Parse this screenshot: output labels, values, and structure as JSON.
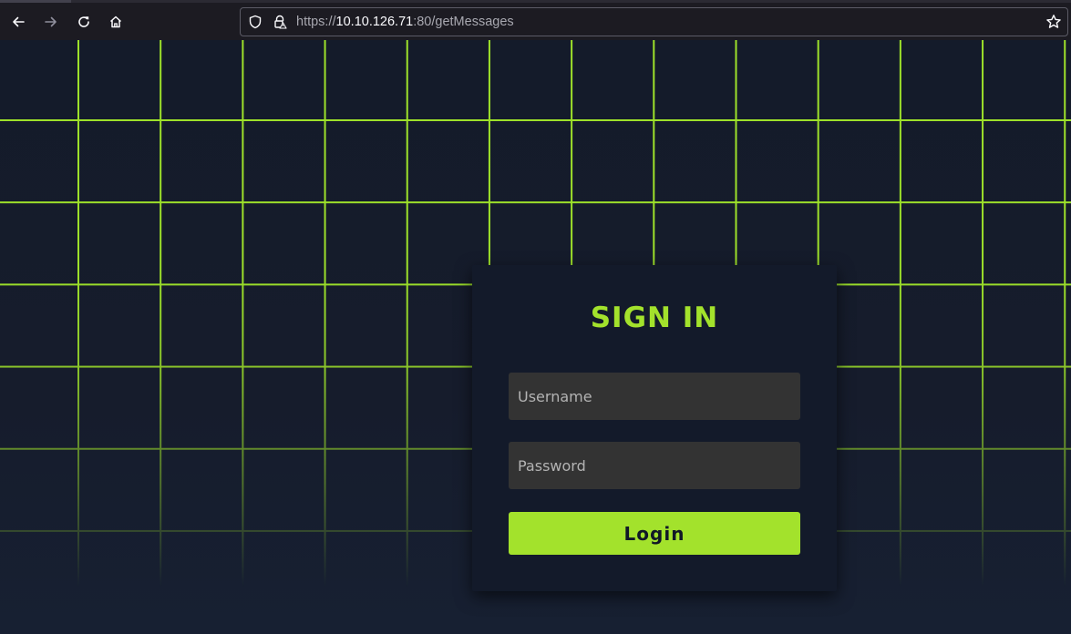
{
  "browser": {
    "url": {
      "scheme": "https://",
      "host": "10.10.126.71",
      "rest": ":80/getMessages"
    },
    "icons": {
      "back": "arrow-left-icon",
      "forward": "arrow-right-icon",
      "reload": "reload-icon",
      "home": "home-icon",
      "shield": "shield-icon",
      "lock": "lock-warning-icon",
      "bookmark": "star-icon"
    }
  },
  "page": {
    "colors": {
      "accent": "#a3e22c",
      "background": "#151b2a",
      "card": "#131a2a",
      "input": "#333333"
    },
    "login": {
      "title": "SIGN IN",
      "username_placeholder": "Username",
      "password_placeholder": "Password",
      "submit_label": "Login"
    }
  }
}
